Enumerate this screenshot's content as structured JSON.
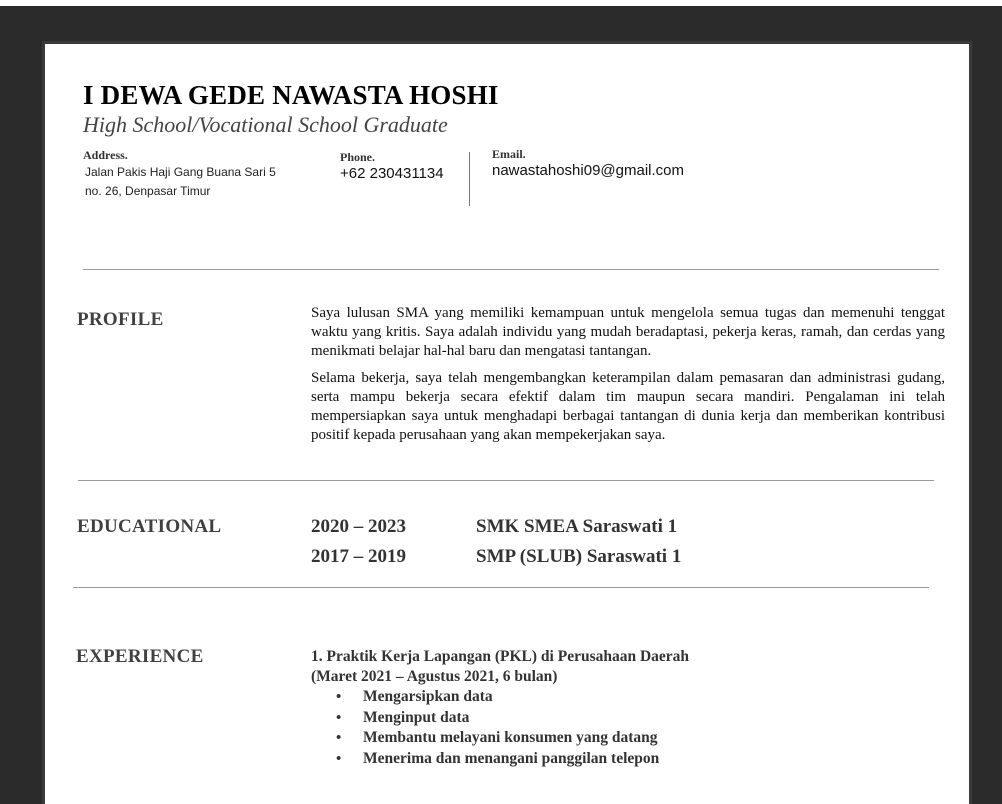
{
  "header": {
    "name": "I DEWA GEDE NAWASTA HOSHI",
    "subtitle": "High School/Vocational School Graduate"
  },
  "contact": {
    "address_label": "Address.",
    "address_line1": "Jalan Pakis Haji Gang Buana Sari 5",
    "address_line2": "no. 26, Denpasar Timur",
    "phone_label": "Phone.",
    "phone": "+62 230431134",
    "email_label": "Email.",
    "email": "nawastahoshi09@gmail.com"
  },
  "profile": {
    "heading": "PROFILE",
    "para1": "Saya lulusan SMA yang memiliki kemampuan untuk mengelola semua tugas dan memenuhi tenggat waktu yang kritis. Saya adalah individu yang mudah beradaptasi, pekerja keras, ramah, dan cerdas yang menikmati belajar hal-hal baru dan mengatasi tantangan.",
    "para2": "Selama bekerja, saya telah mengembangkan keterampilan dalam pemasaran dan administrasi gudang, serta mampu bekerja secara efektif dalam tim maupun secara mandiri. Pengalaman ini telah mempersiapkan saya untuk menghadapi berbagai tantangan di dunia kerja dan memberikan kontribusi positif kepada perusahaan yang akan mempekerjakan saya."
  },
  "education": {
    "heading": "EDUCATIONAL",
    "rows": [
      {
        "years": "2020 – 2023",
        "school": "SMK SMEA Saraswati 1"
      },
      {
        "years": "2017 – 2019",
        "school": "SMP (SLUB) Saraswati 1"
      }
    ]
  },
  "experience": {
    "heading": "EXPERIENCE",
    "title": "1. Praktik Kerja Lapangan (PKL) di Perusahaan Daerah",
    "period": "(Maret 2021 – Agustus 2021, 6 bulan)",
    "bullet_glyph": "•",
    "items": [
      "Mengarsipkan data",
      "Menginput data",
      "Membantu melayani konsumen yang datang",
      "Menerima dan menangani panggilan telepon"
    ]
  }
}
